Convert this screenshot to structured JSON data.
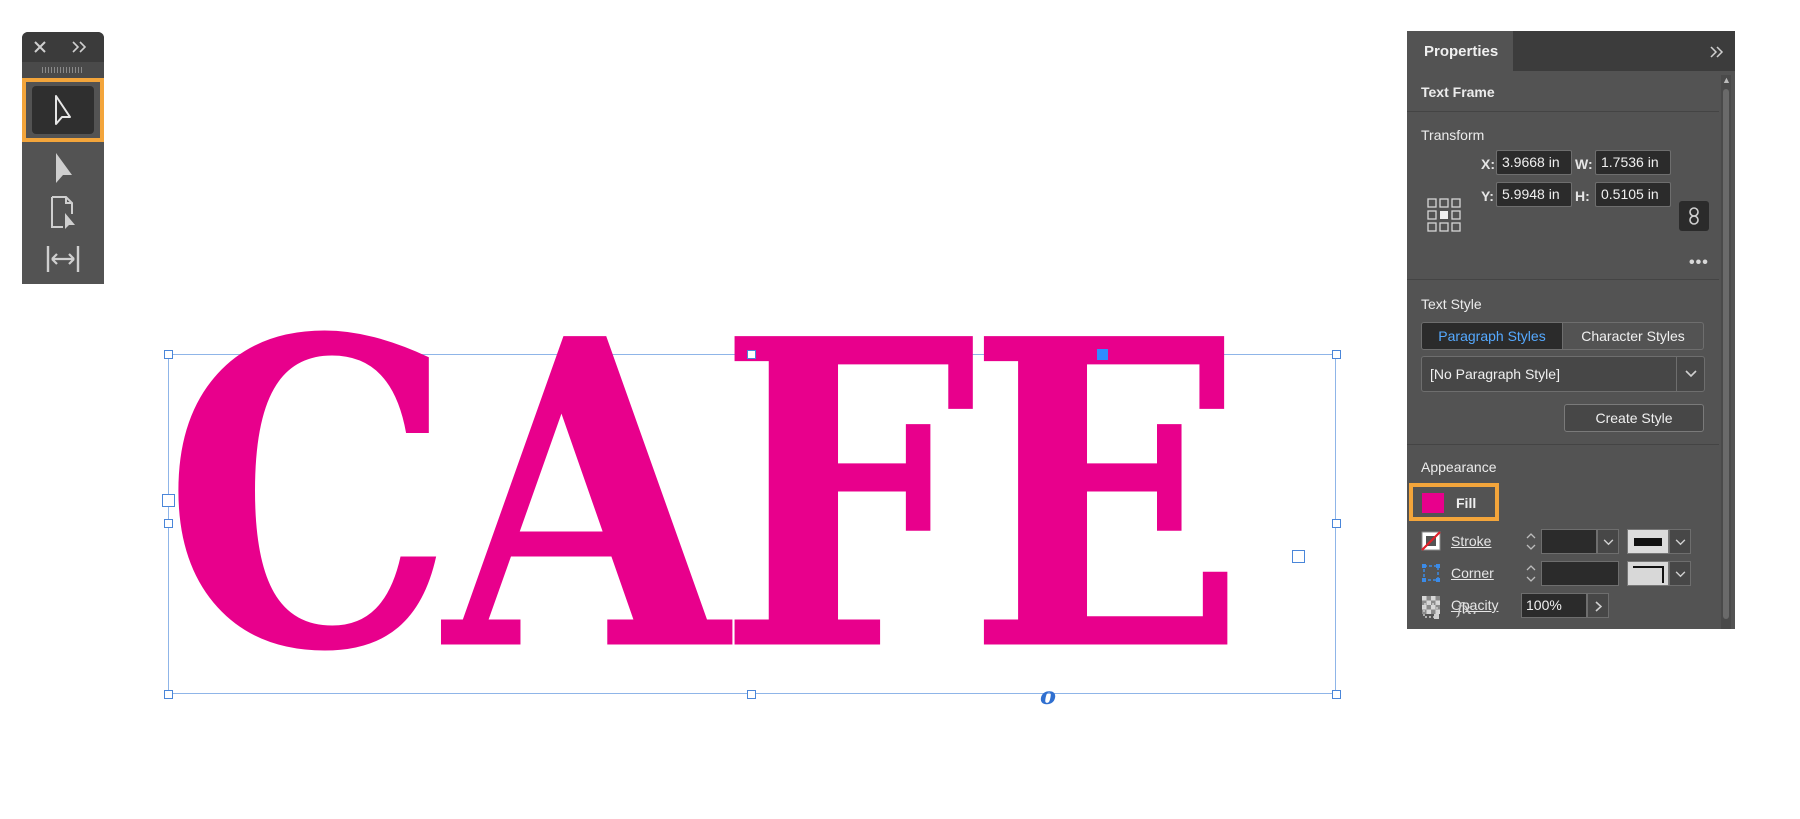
{
  "tools_panel": {
    "close_icon": "close-icon",
    "collapse_icon": "double-chevron-right-icon",
    "tools": [
      {
        "name": "selection-tool",
        "icon": "arrow-outline-icon",
        "selected": true
      },
      {
        "name": "direct-selection-tool",
        "icon": "arrow-filled-icon",
        "selected": false
      },
      {
        "name": "page-tool",
        "icon": "page-arrow-icon",
        "selected": false
      },
      {
        "name": "gap-tool",
        "icon": "gap-icon",
        "selected": false
      }
    ],
    "highlight_color": "#f3a53b"
  },
  "canvas": {
    "text": "CAFE",
    "text_color": "#e8008c",
    "thread_mark": "o"
  },
  "properties": {
    "tab_label": "Properties",
    "section_text_frame": "Text Frame",
    "transform": {
      "title": "Transform",
      "x_label": "X:",
      "x_value": "3.9668 in",
      "y_label": "Y:",
      "y_value": "5.9948 in",
      "w_label": "W:",
      "w_value": "1.7536 in",
      "h_label": "H:",
      "h_value": "0.5105 in",
      "more": "•••"
    },
    "text_style": {
      "title": "Text Style",
      "tabs": [
        "Paragraph Styles",
        "Character Styles"
      ],
      "active_tab": "Paragraph Styles",
      "selected_style": "[No Paragraph Style]",
      "create_button": "Create Style"
    },
    "appearance": {
      "title": "Appearance",
      "fill_label": "Fill",
      "fill_color": "#e8008c",
      "stroke_label": "Stroke",
      "corner_label": "Corner",
      "opacity_label": "Opacity",
      "opacity_value": "100%",
      "fx_label": "fx."
    }
  }
}
